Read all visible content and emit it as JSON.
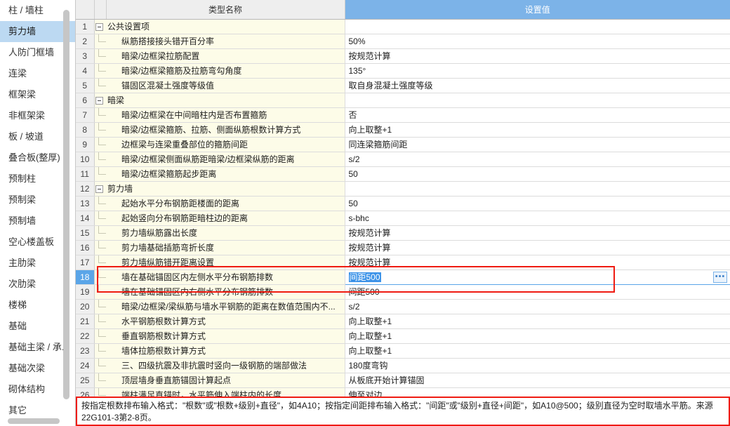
{
  "sidebar": {
    "items": [
      {
        "label": "柱 / 墙柱",
        "selected": false
      },
      {
        "label": "剪力墙",
        "selected": true
      },
      {
        "label": "人防门框墙",
        "selected": false
      },
      {
        "label": "连梁",
        "selected": false
      },
      {
        "label": "框架梁",
        "selected": false
      },
      {
        "label": "非框架梁",
        "selected": false
      },
      {
        "label": "板 / 坡道",
        "selected": false
      },
      {
        "label": "叠合板(整厚)",
        "selected": false
      },
      {
        "label": "预制柱",
        "selected": false
      },
      {
        "label": "预制梁",
        "selected": false
      },
      {
        "label": "预制墙",
        "selected": false
      },
      {
        "label": "空心楼盖板",
        "selected": false
      },
      {
        "label": "主肋梁",
        "selected": false
      },
      {
        "label": "次肋梁",
        "selected": false
      },
      {
        "label": "楼梯",
        "selected": false
      },
      {
        "label": "基础",
        "selected": false
      },
      {
        "label": "基础主梁 / 承...",
        "selected": false
      },
      {
        "label": "基础次梁",
        "selected": false
      },
      {
        "label": "砌体结构",
        "selected": false
      },
      {
        "label": "其它",
        "selected": false
      }
    ]
  },
  "table": {
    "headers": {
      "row_number": "",
      "indent": "",
      "name": "类型名称",
      "value": "设置值"
    },
    "value_header_selected_color": "#7cb3e8",
    "rows": [
      {
        "n": "1",
        "kind": "group",
        "name": "公共设置项",
        "value": ""
      },
      {
        "n": "2",
        "kind": "child",
        "name": "纵筋搭接接头错开百分率",
        "value": "50%"
      },
      {
        "n": "3",
        "kind": "child",
        "name": "暗梁/边框梁拉筋配置",
        "value": "按规范计算"
      },
      {
        "n": "4",
        "kind": "child",
        "name": "暗梁/边框梁箍筋及拉筋弯勾角度",
        "value": "135°"
      },
      {
        "n": "5",
        "kind": "child",
        "name": "锚固区混凝土强度等级值",
        "value": "取自身混凝土强度等级"
      },
      {
        "n": "6",
        "kind": "group",
        "name": "暗梁",
        "value": ""
      },
      {
        "n": "7",
        "kind": "child",
        "name": "暗梁/边框梁在中间暗柱内是否布置箍筋",
        "value": "否"
      },
      {
        "n": "8",
        "kind": "child",
        "name": "暗梁/边框梁箍筋、拉筋、侧面纵筋根数计算方式",
        "value": "向上取整+1"
      },
      {
        "n": "9",
        "kind": "child",
        "name": "边框梁与连梁重叠部位的箍筋间距",
        "value": "同连梁箍筋间距"
      },
      {
        "n": "10",
        "kind": "child",
        "name": "暗梁/边框梁侧面纵筋距暗梁/边框梁纵筋的距离",
        "value": "s/2"
      },
      {
        "n": "11",
        "kind": "child",
        "name": "暗梁/边框梁箍筋起步距离",
        "value": "50"
      },
      {
        "n": "12",
        "kind": "group",
        "name": "剪力墙",
        "value": ""
      },
      {
        "n": "13",
        "kind": "child",
        "name": "起始水平分布钢筋距楼面的距离",
        "value": "50"
      },
      {
        "n": "14",
        "kind": "child",
        "name": "起始竖向分布钢筋距暗柱边的距离",
        "value": "s-bhc"
      },
      {
        "n": "15",
        "kind": "child",
        "name": "剪力墙纵筋露出长度",
        "value": "按规范计算"
      },
      {
        "n": "16",
        "kind": "child",
        "name": "剪力墙基础插筋弯折长度",
        "value": "按规范计算"
      },
      {
        "n": "17",
        "kind": "child",
        "name": "剪力墙纵筋错开距离设置",
        "value": "按规范计算"
      },
      {
        "n": "18",
        "kind": "child",
        "name": "墙在基础锚固区内左侧水平分布钢筋排数",
        "value": "间距500",
        "selected": true,
        "editing": true
      },
      {
        "n": "19",
        "kind": "child",
        "name": "墙在基础锚固区内右侧水平分布钢筋排数",
        "value": "间距500"
      },
      {
        "n": "20",
        "kind": "child",
        "name": "暗梁/边框梁/梁纵筋与墙水平钢筋的距离在数值范围内不...",
        "value": "s/2"
      },
      {
        "n": "21",
        "kind": "child",
        "name": "水平钢筋根数计算方式",
        "value": "向上取整+1"
      },
      {
        "n": "22",
        "kind": "child",
        "name": "垂直钢筋根数计算方式",
        "value": "向上取整+1"
      },
      {
        "n": "23",
        "kind": "child",
        "name": "墙体拉筋根数计算方式",
        "value": "向上取整+1"
      },
      {
        "n": "24",
        "kind": "child",
        "name": "三、四级抗震及非抗震时竖向一级钢筋的端部做法",
        "value": "180度弯钩"
      },
      {
        "n": "25",
        "kind": "child",
        "name": "顶层墙身垂直筋锚固计算起点",
        "value": "从板底开始计算锚固"
      },
      {
        "n": "26",
        "kind": "child",
        "name": "端柱满足直锚时，水平筋伸入端柱内的长度",
        "value": "伸至对边"
      }
    ],
    "ellipsis_button_label": "•••"
  },
  "description": {
    "text": "按指定根数排布输入格式：\"根数\"或\"根数+级别+直径\"，如4A10；按指定间距排布输入格式：\"间距\"或\"级别+直径+间距\"，如A10@500；级别直径为空时取墙水平筋。来源22G101-3第2-8页。"
  },
  "colors": {
    "accent_blue": "#7cb3e8",
    "selection_blue": "#3d93e8",
    "annotation_red": "#ef1b12",
    "row_tint": "#fdfce8",
    "sidebar_selected": "#bcd9f2"
  }
}
